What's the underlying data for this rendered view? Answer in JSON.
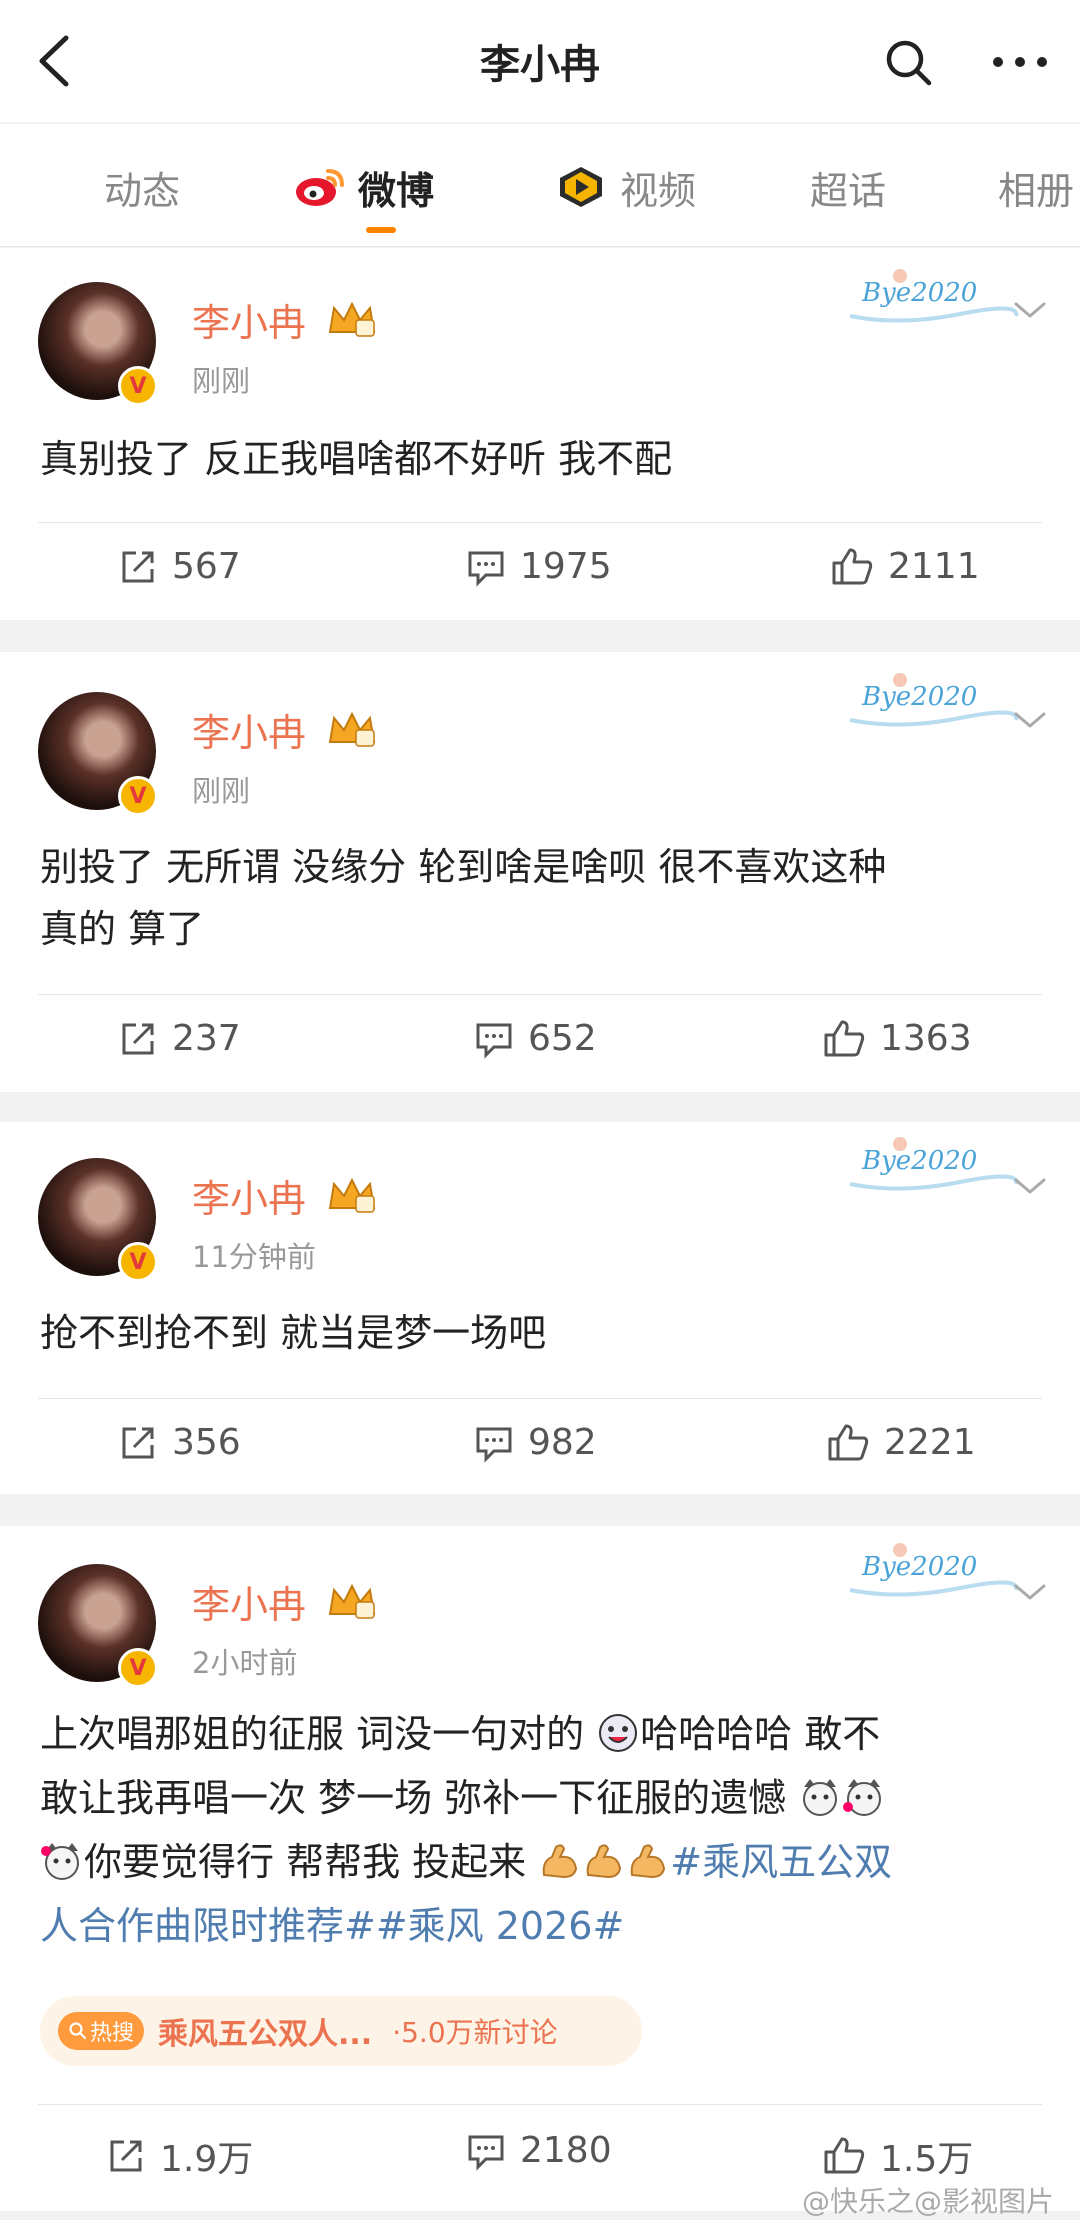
{
  "header": {
    "title": "李小冉"
  },
  "tabs": [
    {
      "label": "动态",
      "icon": null,
      "active": false
    },
    {
      "label": "微博",
      "icon": "weibo-icon",
      "active": true
    },
    {
      "label": "视频",
      "icon": "video-icon",
      "active": false
    },
    {
      "label": "超话",
      "icon": null,
      "active": false
    },
    {
      "label": "相册",
      "icon": null,
      "active": false
    }
  ],
  "posts": [
    {
      "author": "李小冉",
      "time": "刚刚",
      "decoration": "Bye2020",
      "text": "真别投了 反正我唱啥都不好听 我不配",
      "reposts": "567",
      "comments": "1975",
      "likes": "2111"
    },
    {
      "author": "李小冉",
      "time": "刚刚",
      "decoration": "Bye2020",
      "text_lines": [
        "别投了 无所谓 没缘分 轮到啥是啥呗 很不喜欢这种",
        "真的  算了"
      ],
      "reposts": "237",
      "comments": "652",
      "likes": "1363"
    },
    {
      "author": "李小冉",
      "time": "11分钟前",
      "decoration": "Bye2020",
      "text": "抢不到抢不到 就当是梦一场吧",
      "reposts": "356",
      "comments": "982",
      "likes": "2221"
    },
    {
      "author": "李小冉",
      "time": "2小时前",
      "decoration": "Bye2020",
      "line1_a": "上次唱那姐的征服 词没一句对的 ",
      "line1_b": "哈哈哈哈 敢不",
      "line2": "敢让我再唱一次 梦一场 弥补一下征服的遗憾",
      "line3_a": "你要觉得行 帮帮我 投起来",
      "line3_tag": "#乘风五公双",
      "line4_tag": "人合作曲限时推荐##乘风 2026#",
      "hot": {
        "badge": "热搜",
        "title": "乘风五公双人...",
        "count": "·5.0万新讨论"
      },
      "reposts": "1.9万",
      "comments": "2180",
      "likes": "1.5万"
    }
  ],
  "watermark": "@快乐之@影视图片",
  "colors": {
    "accent": "#ff8200",
    "username": "#eb7350",
    "topic": "#507daf"
  }
}
